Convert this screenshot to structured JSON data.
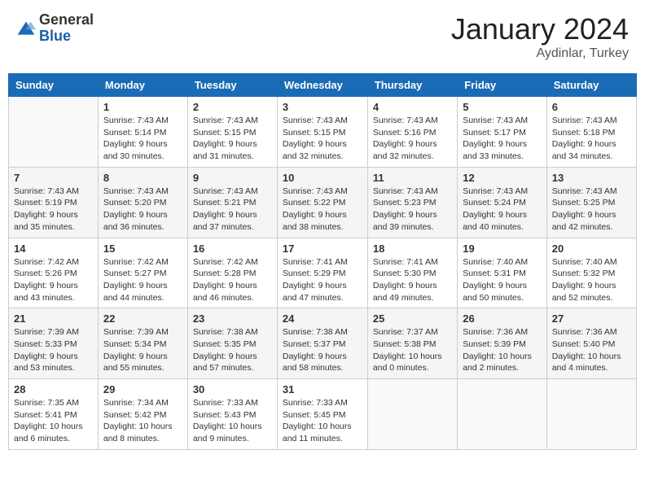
{
  "header": {
    "logo_general": "General",
    "logo_blue": "Blue",
    "month_title": "January 2024",
    "location": "Aydinlar, Turkey"
  },
  "days_of_week": [
    "Sunday",
    "Monday",
    "Tuesday",
    "Wednesday",
    "Thursday",
    "Friday",
    "Saturday"
  ],
  "weeks": [
    [
      {
        "day": "",
        "info": ""
      },
      {
        "day": "1",
        "info": "Sunrise: 7:43 AM\nSunset: 5:14 PM\nDaylight: 9 hours\nand 30 minutes."
      },
      {
        "day": "2",
        "info": "Sunrise: 7:43 AM\nSunset: 5:15 PM\nDaylight: 9 hours\nand 31 minutes."
      },
      {
        "day": "3",
        "info": "Sunrise: 7:43 AM\nSunset: 5:15 PM\nDaylight: 9 hours\nand 32 minutes."
      },
      {
        "day": "4",
        "info": "Sunrise: 7:43 AM\nSunset: 5:16 PM\nDaylight: 9 hours\nand 32 minutes."
      },
      {
        "day": "5",
        "info": "Sunrise: 7:43 AM\nSunset: 5:17 PM\nDaylight: 9 hours\nand 33 minutes."
      },
      {
        "day": "6",
        "info": "Sunrise: 7:43 AM\nSunset: 5:18 PM\nDaylight: 9 hours\nand 34 minutes."
      }
    ],
    [
      {
        "day": "7",
        "info": "Sunrise: 7:43 AM\nSunset: 5:19 PM\nDaylight: 9 hours\nand 35 minutes."
      },
      {
        "day": "8",
        "info": "Sunrise: 7:43 AM\nSunset: 5:20 PM\nDaylight: 9 hours\nand 36 minutes."
      },
      {
        "day": "9",
        "info": "Sunrise: 7:43 AM\nSunset: 5:21 PM\nDaylight: 9 hours\nand 37 minutes."
      },
      {
        "day": "10",
        "info": "Sunrise: 7:43 AM\nSunset: 5:22 PM\nDaylight: 9 hours\nand 38 minutes."
      },
      {
        "day": "11",
        "info": "Sunrise: 7:43 AM\nSunset: 5:23 PM\nDaylight: 9 hours\nand 39 minutes."
      },
      {
        "day": "12",
        "info": "Sunrise: 7:43 AM\nSunset: 5:24 PM\nDaylight: 9 hours\nand 40 minutes."
      },
      {
        "day": "13",
        "info": "Sunrise: 7:43 AM\nSunset: 5:25 PM\nDaylight: 9 hours\nand 42 minutes."
      }
    ],
    [
      {
        "day": "14",
        "info": "Sunrise: 7:42 AM\nSunset: 5:26 PM\nDaylight: 9 hours\nand 43 minutes."
      },
      {
        "day": "15",
        "info": "Sunrise: 7:42 AM\nSunset: 5:27 PM\nDaylight: 9 hours\nand 44 minutes."
      },
      {
        "day": "16",
        "info": "Sunrise: 7:42 AM\nSunset: 5:28 PM\nDaylight: 9 hours\nand 46 minutes."
      },
      {
        "day": "17",
        "info": "Sunrise: 7:41 AM\nSunset: 5:29 PM\nDaylight: 9 hours\nand 47 minutes."
      },
      {
        "day": "18",
        "info": "Sunrise: 7:41 AM\nSunset: 5:30 PM\nDaylight: 9 hours\nand 49 minutes."
      },
      {
        "day": "19",
        "info": "Sunrise: 7:40 AM\nSunset: 5:31 PM\nDaylight: 9 hours\nand 50 minutes."
      },
      {
        "day": "20",
        "info": "Sunrise: 7:40 AM\nSunset: 5:32 PM\nDaylight: 9 hours\nand 52 minutes."
      }
    ],
    [
      {
        "day": "21",
        "info": "Sunrise: 7:39 AM\nSunset: 5:33 PM\nDaylight: 9 hours\nand 53 minutes."
      },
      {
        "day": "22",
        "info": "Sunrise: 7:39 AM\nSunset: 5:34 PM\nDaylight: 9 hours\nand 55 minutes."
      },
      {
        "day": "23",
        "info": "Sunrise: 7:38 AM\nSunset: 5:35 PM\nDaylight: 9 hours\nand 57 minutes."
      },
      {
        "day": "24",
        "info": "Sunrise: 7:38 AM\nSunset: 5:37 PM\nDaylight: 9 hours\nand 58 minutes."
      },
      {
        "day": "25",
        "info": "Sunrise: 7:37 AM\nSunset: 5:38 PM\nDaylight: 10 hours\nand 0 minutes."
      },
      {
        "day": "26",
        "info": "Sunrise: 7:36 AM\nSunset: 5:39 PM\nDaylight: 10 hours\nand 2 minutes."
      },
      {
        "day": "27",
        "info": "Sunrise: 7:36 AM\nSunset: 5:40 PM\nDaylight: 10 hours\nand 4 minutes."
      }
    ],
    [
      {
        "day": "28",
        "info": "Sunrise: 7:35 AM\nSunset: 5:41 PM\nDaylight: 10 hours\nand 6 minutes."
      },
      {
        "day": "29",
        "info": "Sunrise: 7:34 AM\nSunset: 5:42 PM\nDaylight: 10 hours\nand 8 minutes."
      },
      {
        "day": "30",
        "info": "Sunrise: 7:33 AM\nSunset: 5:43 PM\nDaylight: 10 hours\nand 9 minutes."
      },
      {
        "day": "31",
        "info": "Sunrise: 7:33 AM\nSunset: 5:45 PM\nDaylight: 10 hours\nand 11 minutes."
      },
      {
        "day": "",
        "info": ""
      },
      {
        "day": "",
        "info": ""
      },
      {
        "day": "",
        "info": ""
      }
    ]
  ]
}
